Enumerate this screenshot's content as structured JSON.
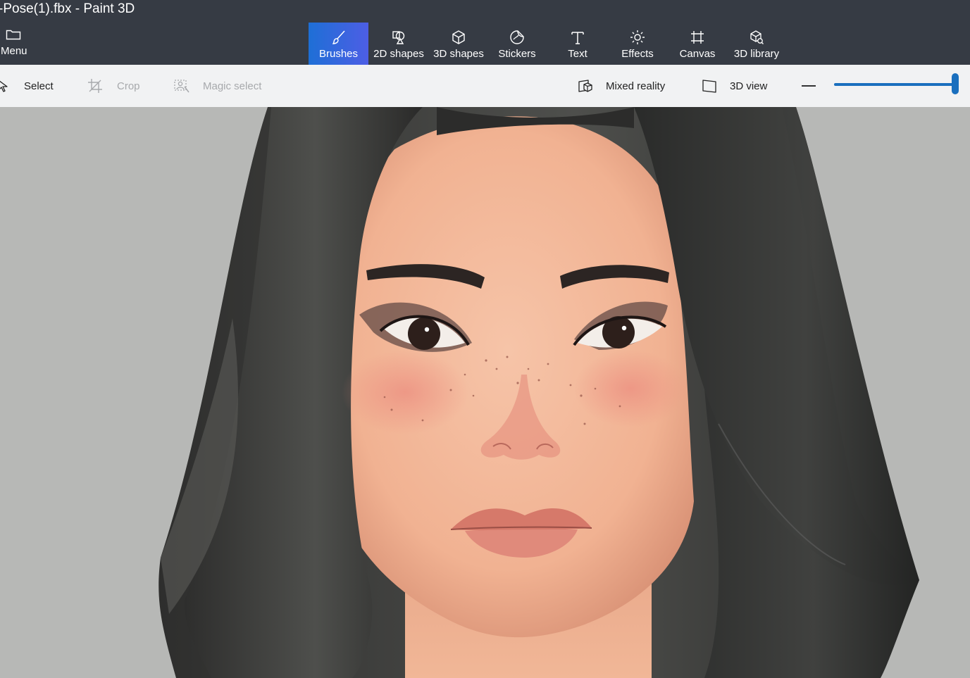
{
  "window": {
    "title": "-Pose(1).fbx - Paint 3D"
  },
  "menu": {
    "label": "Menu",
    "icon": "folder-icon"
  },
  "tools": [
    {
      "label": "Brushes",
      "icon": "brush-icon",
      "active": true
    },
    {
      "label": "2D shapes",
      "icon": "shapes-2d-icon",
      "active": false
    },
    {
      "label": "3D shapes",
      "icon": "cube-icon",
      "active": false
    },
    {
      "label": "Stickers",
      "icon": "sticker-icon",
      "active": false
    },
    {
      "label": "Text",
      "icon": "text-icon",
      "active": false
    },
    {
      "label": "Effects",
      "icon": "sun-icon",
      "active": false
    },
    {
      "label": "Canvas",
      "icon": "canvas-icon",
      "active": false
    },
    {
      "label": "3D library",
      "icon": "library-icon",
      "active": false
    }
  ],
  "toolbar": {
    "select": "Select",
    "crop": "Crop",
    "magic_select": "Magic select",
    "mixed_reality": "Mixed reality",
    "view_3d": "3D view"
  },
  "zoom": {
    "level": 1.0
  },
  "colors": {
    "accent": "#1a6fbe",
    "titlebar": "#363b44",
    "toolbar": "#f1f2f3",
    "canvas": "#b7b8b6"
  }
}
